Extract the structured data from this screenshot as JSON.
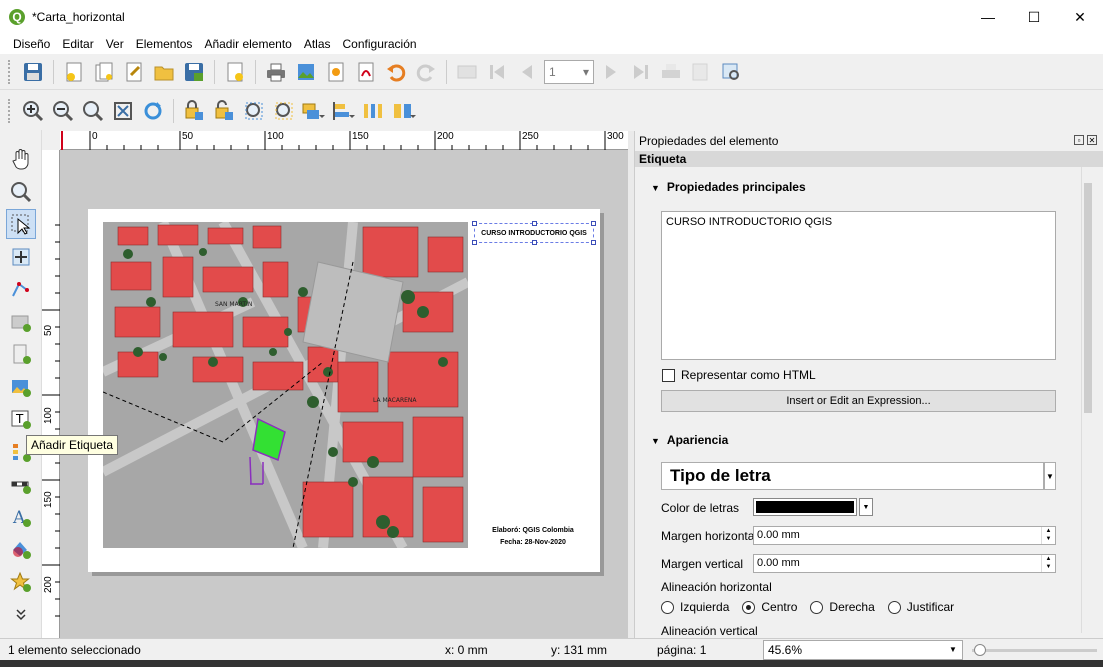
{
  "window": {
    "title": "*Carta_horizontal",
    "app_icon": "Q",
    "minimize": "—",
    "maximize": "☐",
    "close": "✕"
  },
  "menu": [
    "Diseño",
    "Editar",
    "Ver",
    "Elementos",
    "Añadir elemento",
    "Atlas",
    "Configuración"
  ],
  "toolbar": {
    "page_spin_value": "1"
  },
  "ruler": {
    "h_labels": [
      "0",
      "50",
      "100",
      "150",
      "200",
      "250",
      "300"
    ],
    "v_labels": [
      "50",
      "100",
      "150",
      "200"
    ]
  },
  "tooltip": "Añadir Etiqueta",
  "layout": {
    "title_label": "CURSO INTRODUCTORIO QGIS",
    "credit_line1": "Elaboró: QGIS Colombia",
    "credit_line2": "Fecha: 28-Nov-2020",
    "map_labels": [
      "SAN MARTIN",
      "LA MACARENA"
    ]
  },
  "panel": {
    "title": "Propiedades del elemento",
    "item_type": "Etiqueta",
    "section_main": "Propiedades principales",
    "label_text": "CURSO INTRODUCTORIO QGIS",
    "html_checkbox": "Representar como HTML",
    "expression_button": "Insert or Edit an Expression...",
    "section_appearance": "Apariencia",
    "font_button": "Tipo de letra",
    "font_color_label": "Color de letras",
    "font_color": "#000000",
    "h_margin_label": "Margen horizontal",
    "h_margin_value": "0.00 mm",
    "v_margin_label": "Margen vertical",
    "v_margin_value": "0.00 mm",
    "h_align_label": "Alineación horizontal",
    "h_align_options": [
      "Izquierda",
      "Centro",
      "Derecha",
      "Justificar"
    ],
    "h_align_selected": "Centro",
    "v_align_label": "Alineación vertical"
  },
  "status": {
    "selection": "1 elemento seleccionado",
    "x": "x: 0 mm",
    "y": "y: 131 mm",
    "page": "página: 1",
    "zoom": "45.6%"
  }
}
